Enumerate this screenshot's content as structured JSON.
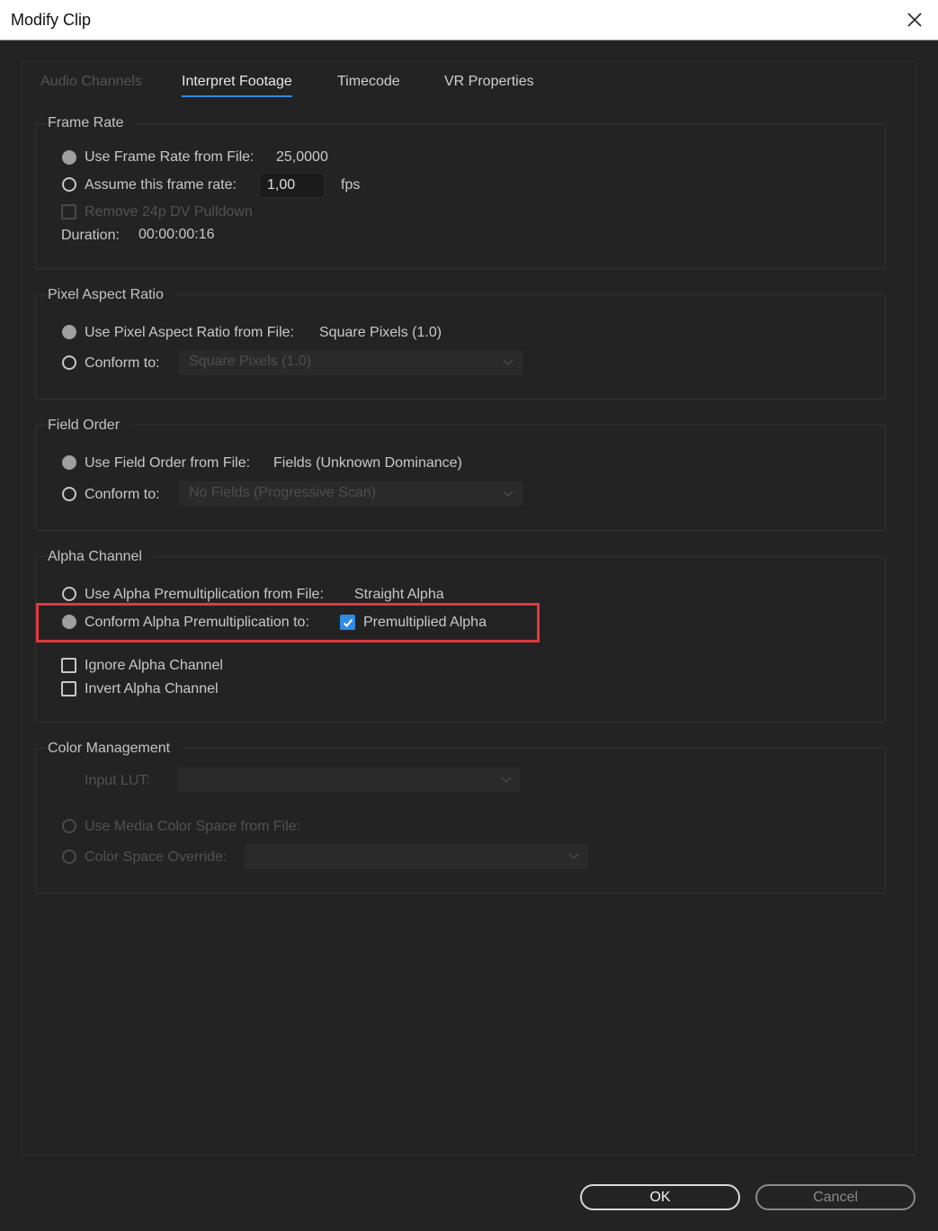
{
  "window": {
    "title": "Modify Clip"
  },
  "tabs": [
    {
      "label": "Audio Channels",
      "state": "disabled"
    },
    {
      "label": "Interpret Footage",
      "state": "active"
    },
    {
      "label": "Timecode",
      "state": "normal"
    },
    {
      "label": "VR Properties",
      "state": "normal"
    }
  ],
  "frame_rate": {
    "title": "Frame Rate",
    "use_from_file_label": "Use Frame Rate from File:",
    "file_value": "25,0000",
    "assume_label": "Assume this frame rate:",
    "assume_value": "1,00",
    "unit": "fps",
    "pulldown_label": "Remove 24p DV Pulldown",
    "duration_label": "Duration:",
    "duration_value": "00:00:00:16"
  },
  "pixel_aspect": {
    "title": "Pixel Aspect Ratio",
    "use_from_file_label": "Use Pixel Aspect Ratio from File:",
    "file_value": "Square Pixels (1.0)",
    "conform_label": "Conform to:",
    "conform_value": "Square Pixels (1.0)"
  },
  "field_order": {
    "title": "Field Order",
    "use_from_file_label": "Use Field Order from File:",
    "file_value": "Fields (Unknown Dominance)",
    "conform_label": "Conform to:",
    "conform_value": "No Fields (Progressive Scan)"
  },
  "alpha": {
    "title": "Alpha Channel",
    "use_from_file_label": "Use Alpha Premultiplication from File:",
    "file_value": "Straight Alpha",
    "conform_label": "Conform Alpha Premultiplication to:",
    "premult_label": "Premultiplied Alpha",
    "ignore_label": "Ignore Alpha Channel",
    "invert_label": "Invert Alpha Channel"
  },
  "color_mgmt": {
    "title": "Color Management",
    "input_lut_label": "Input LUT:",
    "use_media_label": "Use Media Color Space from File:",
    "override_label": "Color Space Override:"
  },
  "buttons": {
    "ok": "OK",
    "cancel": "Cancel"
  },
  "colors": {
    "accent": "#2f8be6",
    "highlight": "#e0393e",
    "background": "#232323"
  }
}
